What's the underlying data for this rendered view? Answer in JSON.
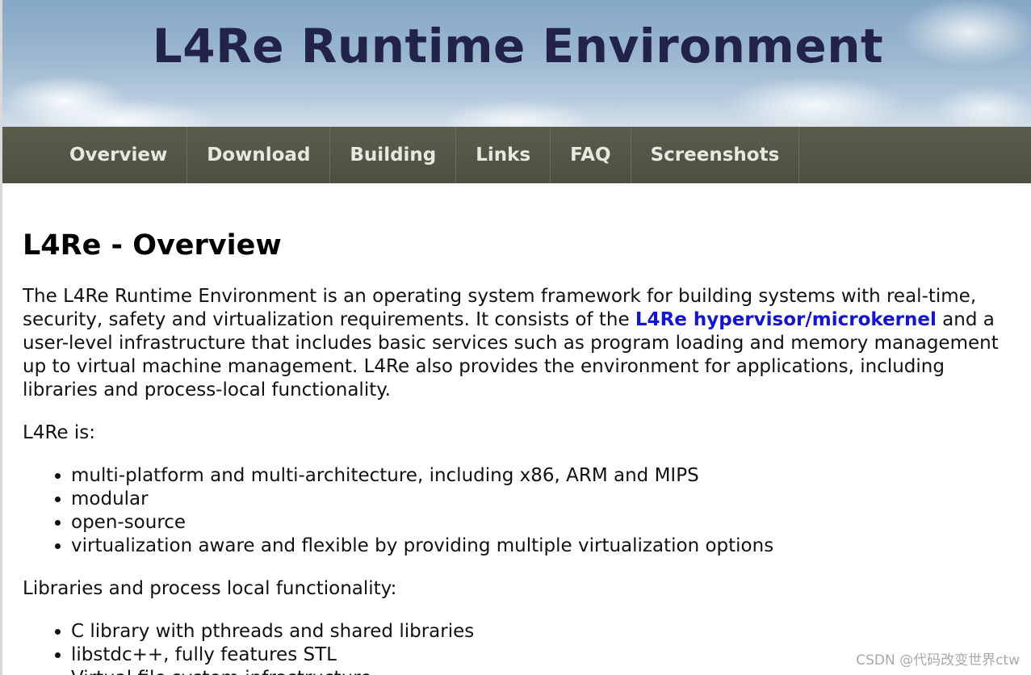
{
  "header": {
    "site_title": "L4Re Runtime Environment"
  },
  "nav": {
    "items": [
      {
        "label": "Overview"
      },
      {
        "label": "Download"
      },
      {
        "label": "Building"
      },
      {
        "label": "Links"
      },
      {
        "label": "FAQ"
      },
      {
        "label": "Screenshots"
      }
    ]
  },
  "main": {
    "heading": "L4Re - Overview",
    "intro": {
      "before_link": "The L4Re Runtime Environment is an operating system framework for building systems with real-time, security, safety and virtualization requirements. It consists of the ",
      "link": "L4Re hypervisor/microkernel",
      "after_link": " and a user-level infrastructure that includes basic services such as program loading and memory management up to virtual machine management. L4Re also provides the environment for applications, including libraries and process-local functionality."
    },
    "is_label": "L4Re is:",
    "is_items": [
      "multi-platform and multi-architecture, including x86, ARM and MIPS",
      "modular",
      "open-source",
      "virtualization aware and flexible by providing multiple virtualization options"
    ],
    "libs_label": "Libraries and process local functionality:",
    "libs_items": [
      "C library with pthreads and shared libraries",
      "libstdc++, fully features STL",
      "Virtual file system infrastructure"
    ]
  },
  "watermark": "CSDN @代码改变世界ctw"
}
